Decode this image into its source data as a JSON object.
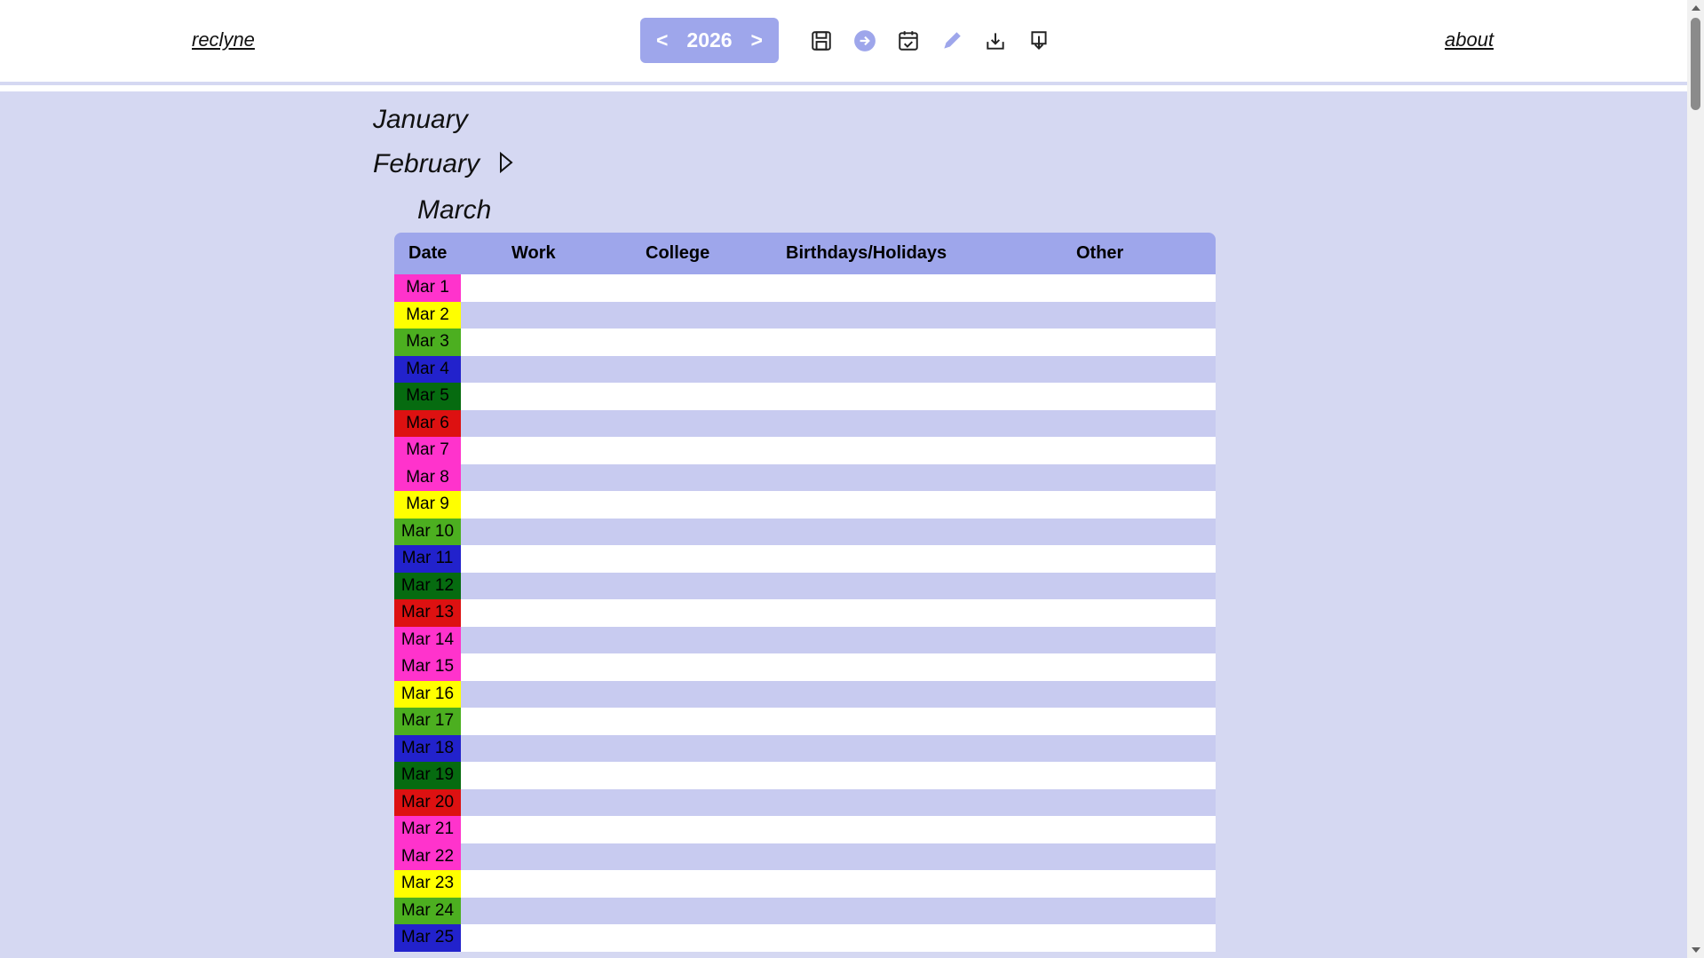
{
  "header": {
    "brand": "reclyne",
    "about": "about",
    "year": "2026",
    "prev": "<",
    "next": ">",
    "icons": [
      "save-icon",
      "arrow-right-circle-icon",
      "calendar-check-icon",
      "pencil-icon",
      "download-icon",
      "bookmark-down-icon"
    ]
  },
  "months": {
    "january": "January",
    "february": "February",
    "march": "March"
  },
  "table": {
    "columns": [
      "Date",
      "Work",
      "College",
      "Birthdays/Holidays",
      "Other"
    ],
    "rows": [
      {
        "date": "Mar 1",
        "color": "#ff33cc"
      },
      {
        "date": "Mar 2",
        "color": "#ffff00"
      },
      {
        "date": "Mar 3",
        "color": "#4caf20"
      },
      {
        "date": "Mar 4",
        "color": "#2222cc"
      },
      {
        "date": "Mar 5",
        "color": "#066b10"
      },
      {
        "date": "Mar 6",
        "color": "#dd1111"
      },
      {
        "date": "Mar 7",
        "color": "#ff33cc"
      },
      {
        "date": "Mar 8",
        "color": "#ff33cc"
      },
      {
        "date": "Mar 9",
        "color": "#ffff00"
      },
      {
        "date": "Mar 10",
        "color": "#4caf20"
      },
      {
        "date": "Mar 11",
        "color": "#2222cc"
      },
      {
        "date": "Mar 12",
        "color": "#066b10"
      },
      {
        "date": "Mar 13",
        "color": "#dd1111"
      },
      {
        "date": "Mar 14",
        "color": "#ff33cc"
      },
      {
        "date": "Mar 15",
        "color": "#ff33cc"
      },
      {
        "date": "Mar 16",
        "color": "#ffff00"
      },
      {
        "date": "Mar 17",
        "color": "#4caf20"
      },
      {
        "date": "Mar 18",
        "color": "#2222cc"
      },
      {
        "date": "Mar 19",
        "color": "#066b10"
      },
      {
        "date": "Mar 20",
        "color": "#dd1111"
      },
      {
        "date": "Mar 21",
        "color": "#ff33cc"
      },
      {
        "date": "Mar 22",
        "color": "#ff33cc"
      },
      {
        "date": "Mar 23",
        "color": "#ffff00"
      },
      {
        "date": "Mar 24",
        "color": "#4caf20"
      },
      {
        "date": "Mar 25",
        "color": "#2222cc"
      }
    ]
  }
}
